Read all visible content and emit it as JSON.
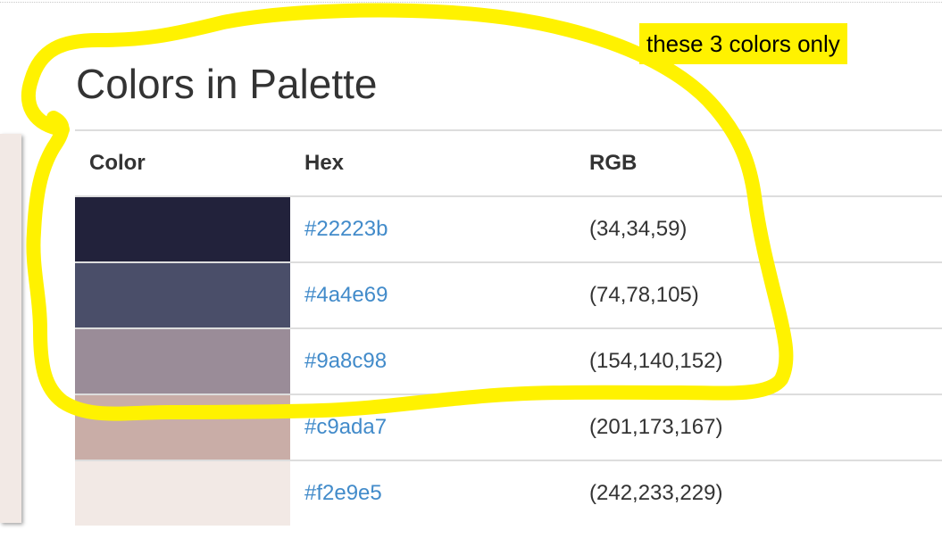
{
  "page": {
    "title": "Colors in Palette"
  },
  "table": {
    "headers": {
      "color": "Color",
      "hex": "Hex",
      "rgb": "RGB"
    },
    "rows": [
      {
        "swatch": "#22223b",
        "hex": "#22223b",
        "rgb": "(34,34,59)"
      },
      {
        "swatch": "#4a4e69",
        "hex": "#4a4e69",
        "rgb": "(74,78,105)"
      },
      {
        "swatch": "#9a8c98",
        "hex": "#9a8c98",
        "rgb": "(154,140,152)"
      },
      {
        "swatch": "#c9ada7",
        "hex": "#c9ada7",
        "rgb": "(201,173,167)"
      },
      {
        "swatch": "#f2e9e5",
        "hex": "#f2e9e5",
        "rgb": "(242,233,229)"
      }
    ]
  },
  "annotation": {
    "note": "these 3 colors only",
    "highlight_color": "#fff200"
  },
  "colors": {
    "link": "#428bca",
    "border": "#dddddd",
    "side_panel": "#f2e9e5"
  }
}
